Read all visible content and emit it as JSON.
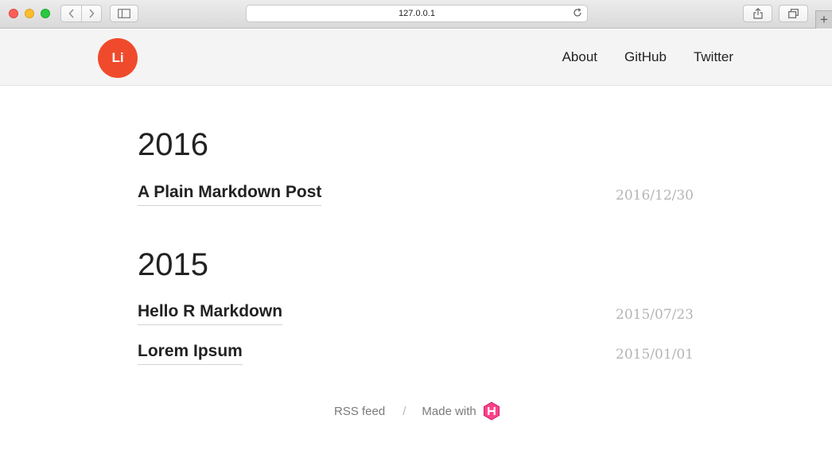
{
  "browser": {
    "url": "127.0.0.1",
    "icons": {
      "back": "chevron-left-icon",
      "forward": "chevron-right-icon",
      "sidebar": "sidebar-icon",
      "reload": "reload-icon",
      "share": "share-icon",
      "tabs": "tabs-icon",
      "new_tab": "plus-icon"
    }
  },
  "header": {
    "logo_text": "Li",
    "logo_color": "#f04a2c",
    "menu": [
      {
        "label": "About"
      },
      {
        "label": "GitHub"
      },
      {
        "label": "Twitter"
      }
    ]
  },
  "archive": [
    {
      "year": "2016",
      "posts": [
        {
          "title": "A Plain Markdown Post",
          "date": "2016/12/30"
        }
      ]
    },
    {
      "year": "2015",
      "posts": [
        {
          "title": "Hello R Markdown",
          "date": "2015/07/23"
        },
        {
          "title": "Lorem Ipsum",
          "date": "2015/01/01"
        }
      ]
    }
  ],
  "footer": {
    "rss_label": "RSS feed",
    "separator": "/",
    "made_with_label": "Made with",
    "hugo_icon": "hugo-logo-icon",
    "hugo_color": "#ff4088"
  }
}
